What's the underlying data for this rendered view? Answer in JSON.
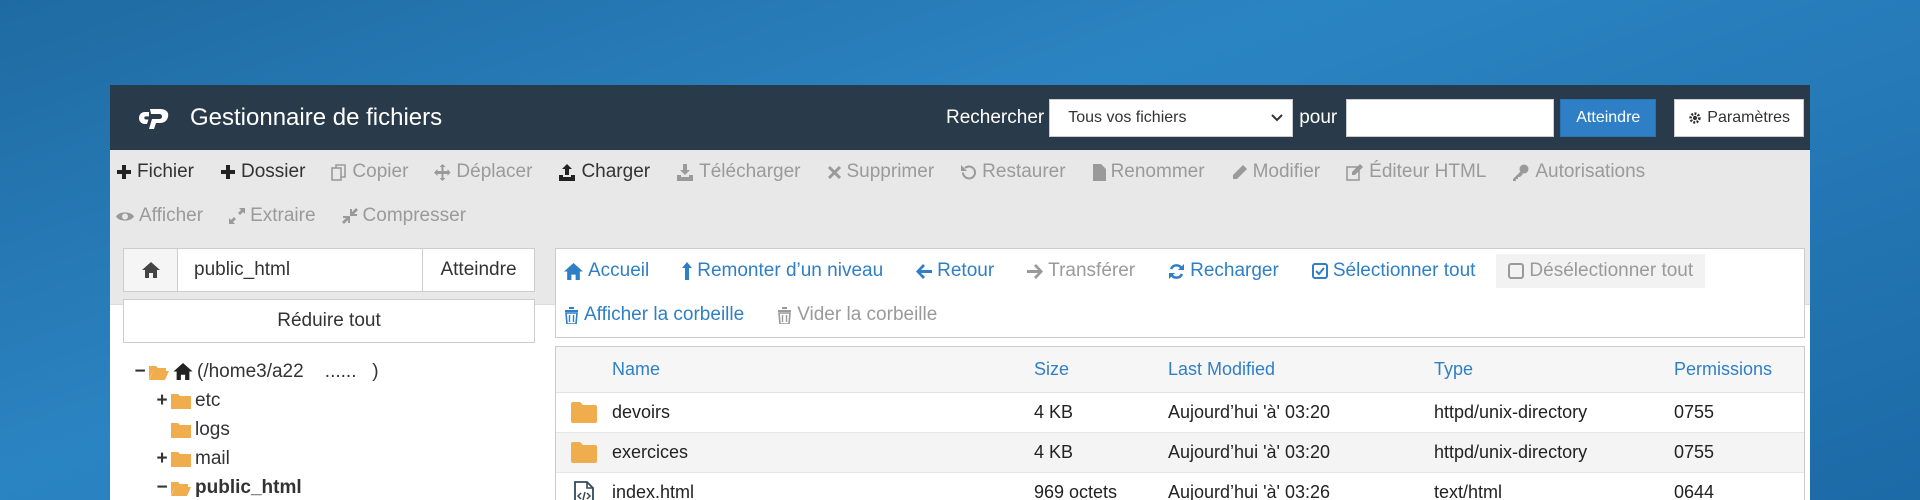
{
  "app": {
    "title": "Gestionnaire de fichiers",
    "logo_icon": "cpanel-logo-icon"
  },
  "search": {
    "label": "Rechercher",
    "scope_selected": "Tous vos fichiers",
    "for_label": "pour",
    "query_value": "",
    "go_label": "Atteindre",
    "settings_label": "Paramètres"
  },
  "toolbar": {
    "row1": [
      {
        "label": "Fichier",
        "icon": "plus-icon",
        "enabled": true
      },
      {
        "label": "Dossier",
        "icon": "plus-icon",
        "enabled": true
      },
      {
        "label": "Copier",
        "icon": "copy-icon",
        "enabled": false
      },
      {
        "label": "Déplacer",
        "icon": "move-icon",
        "enabled": false
      },
      {
        "label": "Charger",
        "icon": "upload-icon",
        "enabled": true
      },
      {
        "label": "Télécharger",
        "icon": "download-icon",
        "enabled": false
      },
      {
        "label": "Supprimer",
        "icon": "times-icon",
        "enabled": false
      },
      {
        "label": "Restaurer",
        "icon": "undo-icon",
        "enabled": false
      },
      {
        "label": "Renommer",
        "icon": "file-icon",
        "enabled": false
      },
      {
        "label": "Modifier",
        "icon": "pencil-icon",
        "enabled": false
      },
      {
        "label": "Éditeur HTML",
        "icon": "edit-icon",
        "enabled": false
      },
      {
        "label": "Autorisations",
        "icon": "key-icon",
        "enabled": false
      }
    ],
    "row2": [
      {
        "label": "Afficher",
        "icon": "eye-icon",
        "enabled": false
      },
      {
        "label": "Extraire",
        "icon": "expand-icon",
        "enabled": false
      },
      {
        "label": "Compresser",
        "icon": "compress-icon",
        "enabled": false
      }
    ]
  },
  "left": {
    "path_value": "public_html",
    "go_label": "Atteindre",
    "collapse_label": "Réduire tout",
    "tree": {
      "root": "(/home3/a22    ......   )",
      "items": [
        "etc",
        "logs",
        "mail",
        "public_html"
      ]
    }
  },
  "actions": {
    "row1": [
      {
        "label": "Accueil",
        "icon": "home-icon",
        "enabled": true
      },
      {
        "label": "Remonter d’un niveau",
        "icon": "level-up-icon",
        "enabled": true
      },
      {
        "label": "Retour",
        "icon": "arrow-left-icon",
        "enabled": true
      },
      {
        "label": "Transférer",
        "icon": "arrow-right-icon",
        "enabled": false
      },
      {
        "label": "Recharger",
        "icon": "refresh-icon",
        "enabled": true
      },
      {
        "label": "Sélectionner tout",
        "icon": "check-square-icon",
        "enabled": true
      },
      {
        "label": "Désélectionner tout",
        "icon": "square-icon",
        "enabled": false
      }
    ],
    "row2": [
      {
        "label": "Afficher la corbeille",
        "icon": "trash-icon",
        "enabled": true
      },
      {
        "label": "Vider la corbeille",
        "icon": "trash-icon",
        "enabled": false
      }
    ]
  },
  "table": {
    "headers": {
      "name": "Name",
      "size": "Size",
      "modified": "Last Modified",
      "type": "Type",
      "perms": "Permissions"
    },
    "rows": [
      {
        "icon": "folder-icon",
        "name": "devoirs",
        "size": "4 KB",
        "modified": "Aujourd’hui 'à' 03:20",
        "type": "httpd/unix-directory",
        "perms": "0755"
      },
      {
        "icon": "folder-icon",
        "name": "exercices",
        "size": "4 KB",
        "modified": "Aujourd’hui 'à' 03:20",
        "type": "httpd/unix-directory",
        "perms": "0755"
      },
      {
        "icon": "html-file-icon",
        "name": "index.html",
        "size": "969 octets",
        "modified": "Aujourd’hui 'à' 03:26",
        "type": "text/html",
        "perms": "0644"
      }
    ]
  },
  "colors": {
    "topbar": "#293a4a",
    "accent": "#2f7fc6",
    "folder": "#f0ad4e",
    "background": "#2478b5"
  }
}
